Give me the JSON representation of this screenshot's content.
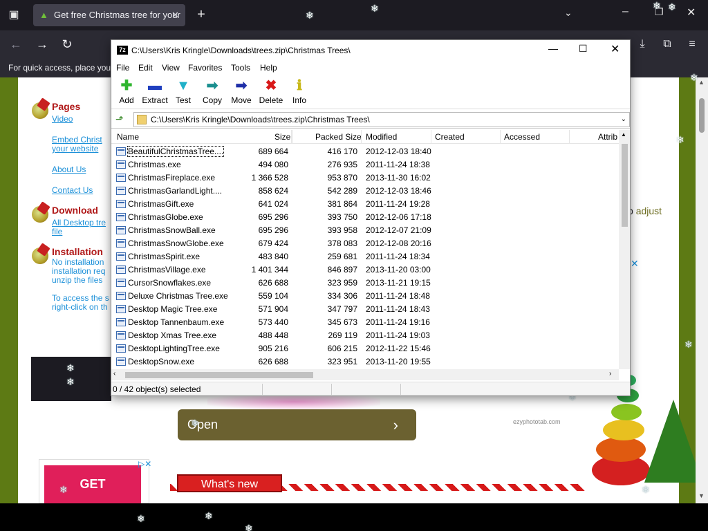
{
  "browser": {
    "tab_title": "Get free Christmas tree for your",
    "bookmarks_text": "For quick access, place your"
  },
  "page": {
    "sections": [
      {
        "title": "Pages",
        "links": [
          "Video",
          "Embed Christ",
          "your website",
          "About Us",
          "Contact Us"
        ]
      },
      {
        "title": "Download",
        "links": [
          "All Desktop tre",
          "file"
        ]
      },
      {
        "title": "Installation",
        "text": [
          "No installation",
          "installation req",
          "unzip the files",
          "To access the s",
          "right-click on th"
        ]
      }
    ],
    "open_label": "Open",
    "adjust_text": "adjust",
    "ad_label": "GET TEMPLATES",
    "whats_new": "What's new",
    "watermark": "ezyphototab.com"
  },
  "zip": {
    "title": "C:\\Users\\Kris Kringle\\Downloads\\trees.zip\\Christmas Trees\\",
    "menu": [
      "File",
      "Edit",
      "View",
      "Favorites",
      "Tools",
      "Help"
    ],
    "toolbar": [
      {
        "label": "Add",
        "icon": "add-icon",
        "color": "#2fb52f"
      },
      {
        "label": "Extract",
        "icon": "extract-icon",
        "color": "#1f3fbf"
      },
      {
        "label": "Test",
        "icon": "test-icon",
        "color": "#20b0c8"
      },
      {
        "label": "Copy",
        "icon": "copy-icon",
        "color": "#1a8f8f"
      },
      {
        "label": "Move",
        "icon": "move-icon",
        "color": "#1f2fa8"
      },
      {
        "label": "Delete",
        "icon": "delete-icon",
        "color": "#d81818"
      },
      {
        "label": "Info",
        "icon": "info-icon",
        "color": "#d8c818"
      }
    ],
    "path": "C:\\Users\\Kris Kringle\\Downloads\\trees.zip\\Christmas Trees\\",
    "columns": [
      "Name",
      "Size",
      "Packed Size",
      "Modified",
      "Created",
      "Accessed",
      "Attrib"
    ],
    "rows": [
      {
        "name": "BeautifulChristmasTree....",
        "size": "689 664",
        "packed": "416 170",
        "modified": "2012-12-03 18:40"
      },
      {
        "name": "Christmas.exe",
        "size": "494 080",
        "packed": "276 935",
        "modified": "2011-11-24 18:38"
      },
      {
        "name": "ChristmasFireplace.exe",
        "size": "1 366 528",
        "packed": "953 870",
        "modified": "2013-11-30 16:02"
      },
      {
        "name": "ChristmasGarlandLight....",
        "size": "858 624",
        "packed": "542 289",
        "modified": "2012-12-03 18:46"
      },
      {
        "name": "ChristmasGift.exe",
        "size": "641 024",
        "packed": "381 864",
        "modified": "2011-11-24 19:28"
      },
      {
        "name": "ChristmasGlobe.exe",
        "size": "695 296",
        "packed": "393 750",
        "modified": "2012-12-06 17:18"
      },
      {
        "name": "ChristmasSnowBall.exe",
        "size": "695 296",
        "packed": "393 958",
        "modified": "2012-12-07 21:09"
      },
      {
        "name": "ChristmasSnowGlobe.exe",
        "size": "679 424",
        "packed": "378 083",
        "modified": "2012-12-08 20:16"
      },
      {
        "name": "ChristmasSpirit.exe",
        "size": "483 840",
        "packed": "259 681",
        "modified": "2011-11-24 18:34"
      },
      {
        "name": "ChristmasVillage.exe",
        "size": "1 401 344",
        "packed": "846 897",
        "modified": "2013-11-20 03:00"
      },
      {
        "name": "CursorSnowflakes.exe",
        "size": "626 688",
        "packed": "323 959",
        "modified": "2013-11-21 19:15"
      },
      {
        "name": "Deluxe Christmas Tree.exe",
        "size": "559 104",
        "packed": "334 306",
        "modified": "2011-11-24 18:48"
      },
      {
        "name": "Desktop Magic Tree.exe",
        "size": "571 904",
        "packed": "347 797",
        "modified": "2011-11-24 18:43"
      },
      {
        "name": "Desktop Tannenbaum.exe",
        "size": "573 440",
        "packed": "345 673",
        "modified": "2011-11-24 19:16"
      },
      {
        "name": "Desktop Xmas Tree.exe",
        "size": "488 448",
        "packed": "269 119",
        "modified": "2011-11-24 19:03"
      },
      {
        "name": "DesktopLightingTree.exe",
        "size": "905 216",
        "packed": "606 215",
        "modified": "2012-11-22 15:46"
      },
      {
        "name": "DesktopSnow.exe",
        "size": "626 688",
        "packed": "323 951",
        "modified": "2013-11-20 19:55"
      }
    ],
    "status": "0 / 42 object(s) selected"
  }
}
